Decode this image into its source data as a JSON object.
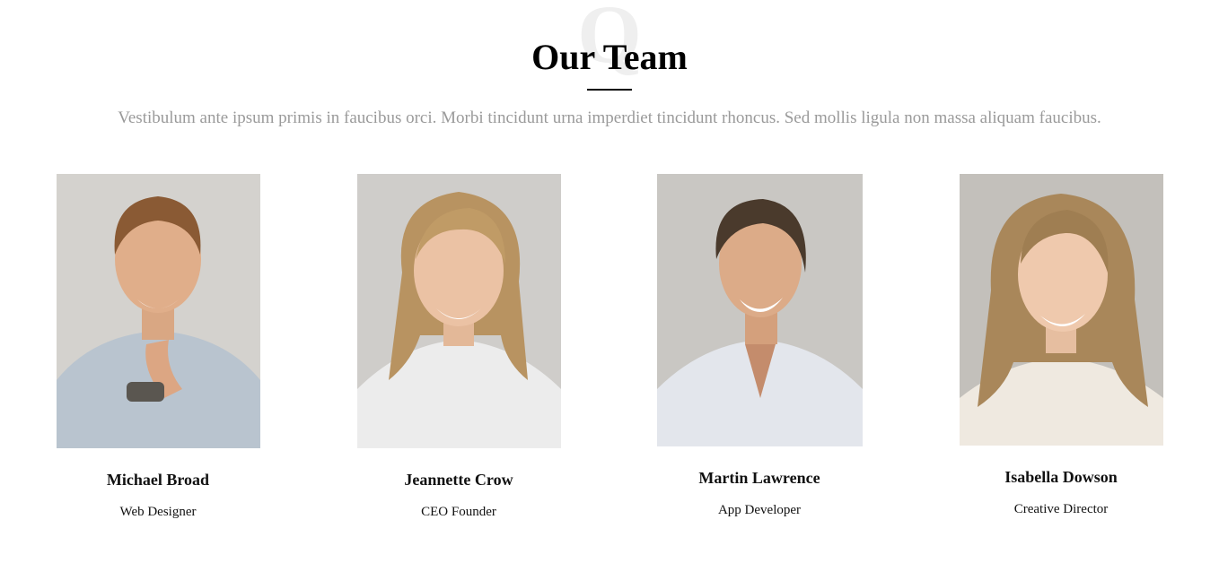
{
  "section": {
    "watermark": "Q",
    "title": "Our Team",
    "subtitle": "Vestibulum ante ipsum primis in faucibus orci. Morbi tincidunt urna imperdiet tincidunt rhoncus. Sed mollis ligula non massa aliquam faucibus."
  },
  "team": [
    {
      "name": "Michael Broad",
      "role": "Web Designer"
    },
    {
      "name": "Jeannette Crow",
      "role": "CEO Founder"
    },
    {
      "name": "Martin Lawrence",
      "role": "App Developer"
    },
    {
      "name": "Isabella Dowson",
      "role": "Creative Director"
    }
  ]
}
